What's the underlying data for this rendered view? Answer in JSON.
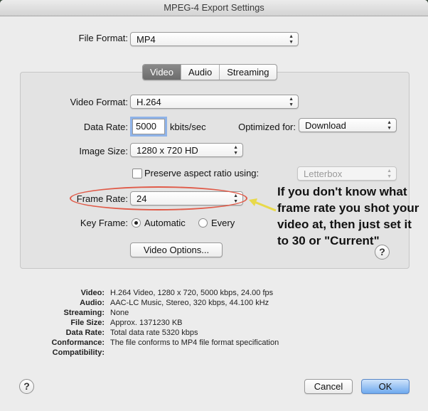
{
  "window": {
    "title": "MPEG-4 Export Settings"
  },
  "file_format": {
    "label": "File Format:",
    "value": "MP4"
  },
  "tabs": [
    {
      "label": "Video",
      "active": true
    },
    {
      "label": "Audio",
      "active": false
    },
    {
      "label": "Streaming",
      "active": false
    }
  ],
  "video": {
    "format_label": "Video Format:",
    "format_value": "H.264",
    "data_rate_label": "Data Rate:",
    "data_rate_value": "5000",
    "data_rate_unit": "kbits/sec",
    "optimized_label": "Optimized for:",
    "optimized_value": "Download",
    "image_size_label": "Image Size:",
    "image_size_value": "1280 x 720 HD",
    "preserve_label": "Preserve aspect ratio using:",
    "preserve_checked": false,
    "preserve_value": "Letterbox",
    "frame_rate_label": "Frame Rate:",
    "frame_rate_value": "24",
    "key_frame_label": "Key Frame:",
    "key_frame_options": [
      "Automatic",
      "Every"
    ],
    "key_frame_selected": "Automatic",
    "options_button": "Video Options..."
  },
  "annotation": {
    "text": "If you don't know what frame rate you shot your video at, then just set it to 30 or \"Current\"",
    "color": "#e05b49",
    "arrow_color": "#e8d94a"
  },
  "summary": [
    {
      "key": "Video:",
      "value": "H.264 Video, 1280 x 720, 5000 kbps, 24.00 fps"
    },
    {
      "key": "Audio:",
      "value": "AAC-LC Music, Stereo, 320 kbps, 44.100 kHz"
    },
    {
      "key": "Streaming:",
      "value": "None"
    },
    {
      "key": "File Size:",
      "value": "Approx. 1371230 KB"
    },
    {
      "key": "Data Rate:",
      "value": "Total data rate 5320 kbps"
    },
    {
      "key": "Conformance:",
      "value": "The file conforms to MP4 file format specification"
    },
    {
      "key": "Compatibility:",
      "value": ""
    }
  ],
  "buttons": {
    "help": "?",
    "cancel": "Cancel",
    "ok": "OK"
  },
  "icons": {
    "popup": "up-down-chevron-icon",
    "help": "question-mark-icon",
    "arrow": "annotation-arrow-icon"
  }
}
